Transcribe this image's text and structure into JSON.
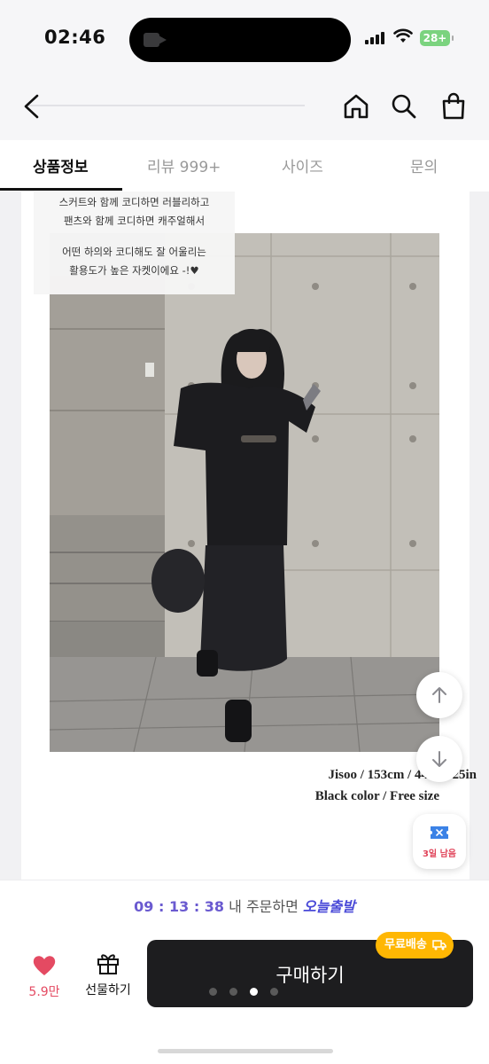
{
  "status": {
    "time": "02:46",
    "battery": "28+"
  },
  "header": {
    "back_icon": "chevron-left-icon",
    "home_icon": "home-icon",
    "search_icon": "search-icon",
    "cart_icon": "shopping-bag-icon"
  },
  "tabs": [
    {
      "label": "상품정보",
      "active": true
    },
    {
      "label": "리뷰 999+",
      "active": false
    },
    {
      "label": "사이즈",
      "active": false
    },
    {
      "label": "문의",
      "active": false
    }
  ],
  "caption": {
    "line1": "스커트와 함께 코디하면 러블리하고",
    "line2": "팬츠와 함께 코디하면  캐주얼해서",
    "line3": "어떤 하의와 코디해도 잘 어울리는",
    "line4": "활용도가 높은 자켓이에요 -!♥"
  },
  "model_info": {
    "line1": "Jisoo / 153cm / 44kg / 25in",
    "line2": "Black color / Free size"
  },
  "coupon": {
    "icon": "ticket-icon",
    "label": "3일 남음"
  },
  "timer": {
    "countdown": "09 : 13 : 38",
    "middle": "내 주문하면",
    "highlight": "오늘출발"
  },
  "actions": {
    "like_count": "5.9만",
    "gift_label": "선물하기",
    "buy_label": "구매하기",
    "shipping_badge": "무료배송"
  },
  "colors": {
    "accent_purple": "#6a5ad0",
    "like_red": "#e44a62",
    "badge_yellow": "#ffb703",
    "buy_bg": "#1d1d1f"
  }
}
